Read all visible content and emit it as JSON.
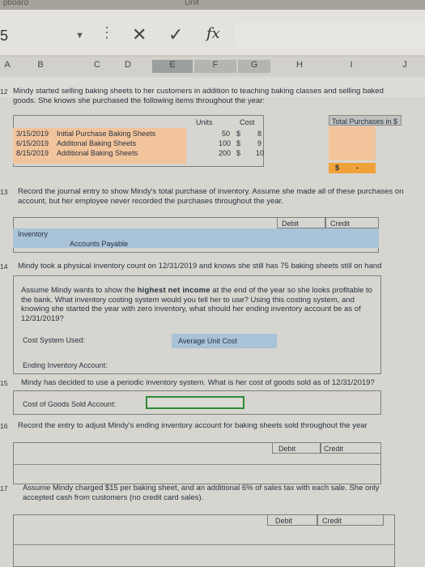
{
  "top_tabs": [
    "pboard",
    "",
    "Unit",
    "",
    ""
  ],
  "toolbar": {
    "cell_ref": "5",
    "dropdown_icon": "chevron-down",
    "cancel_symbol": "✕",
    "enter_symbol": "✓",
    "fx_label": "fx"
  },
  "columns": [
    "A",
    "B",
    "C",
    "D",
    "E",
    "F",
    "G",
    "H",
    "I",
    "J"
  ],
  "q12": {
    "row": "12",
    "text": "Mindy started selling baking sheets to her customers in addition to teaching baking classes and selling baked goods. She knows she purchased the following items throughout the year:",
    "header_units": "Units",
    "header_cost": "Cost",
    "header_total": "Total Purchases in $",
    "purchases": [
      {
        "date": "3/15/2019",
        "desc": "Initial Purchase Baking Sheets",
        "units": "50",
        "cur": "$",
        "cost": "8"
      },
      {
        "date": "6/15/2019",
        "desc": "Additonal Baking Sheets",
        "units": "100",
        "cur": "$",
        "cost": "9"
      },
      {
        "date": "8/15/2019",
        "desc": "Additional Baking Sheets",
        "units": "200",
        "cur": "$",
        "cost": "10"
      }
    ],
    "total_currency": "$",
    "total_dash": "-"
  },
  "q13": {
    "row": "13",
    "text": "Record the journal entry to show Mindy's total purchase of inventory. Assume she made all of these purchases on account, but her employee never recorded the purchases throughout the year.",
    "debit": "Debit",
    "credit": "Credit",
    "line1": "Inventory",
    "line2": "Accounts Payable"
  },
  "q14": {
    "row": "14",
    "text": "Mindy took a physical inventory count on 12/31/2019 and knows she still has 75 baking sheets still on hand",
    "para_pre": "Assume Mindy wants to show the ",
    "para_bold": "highest net income",
    "para_post": " at the end of the year so she looks profitable to the bank. What inventory costing system would you tell her to use? Using this costing system, and knowing she started the year with zero inventory, what should her ending inventory account be as of 12/31/2019?",
    "cost_system_label": "Cost System Used:",
    "cost_system_value": "Average Unit Cost",
    "ending_inventory_label": "Ending Inventory Account:"
  },
  "q15": {
    "row": "15",
    "text": "Mindy has decided to use a periodic inventory system. What is her cost of goods sold as of 12/31/2019?",
    "cogs_label": "Cost of Goods Sold Account:"
  },
  "q16": {
    "row": "16",
    "text": "Record the entry to adjust Mindy's ending inventory account for baking sheets sold throughout the year",
    "debit": "Debit",
    "credit": "Credit"
  },
  "q17": {
    "row": "17",
    "text": "Assume Mindy charged $15 per baking sheet, and an additional 6% of sales tax with each sale. She only accepted cash from customers (no credit card sales).",
    "debit": "Debit",
    "credit": "Credit"
  },
  "colors": {
    "peach": "#f2c49c",
    "highlight": "#a9c3d8",
    "orange": "#f0a23a",
    "green_border": "#2e8a3a"
  }
}
